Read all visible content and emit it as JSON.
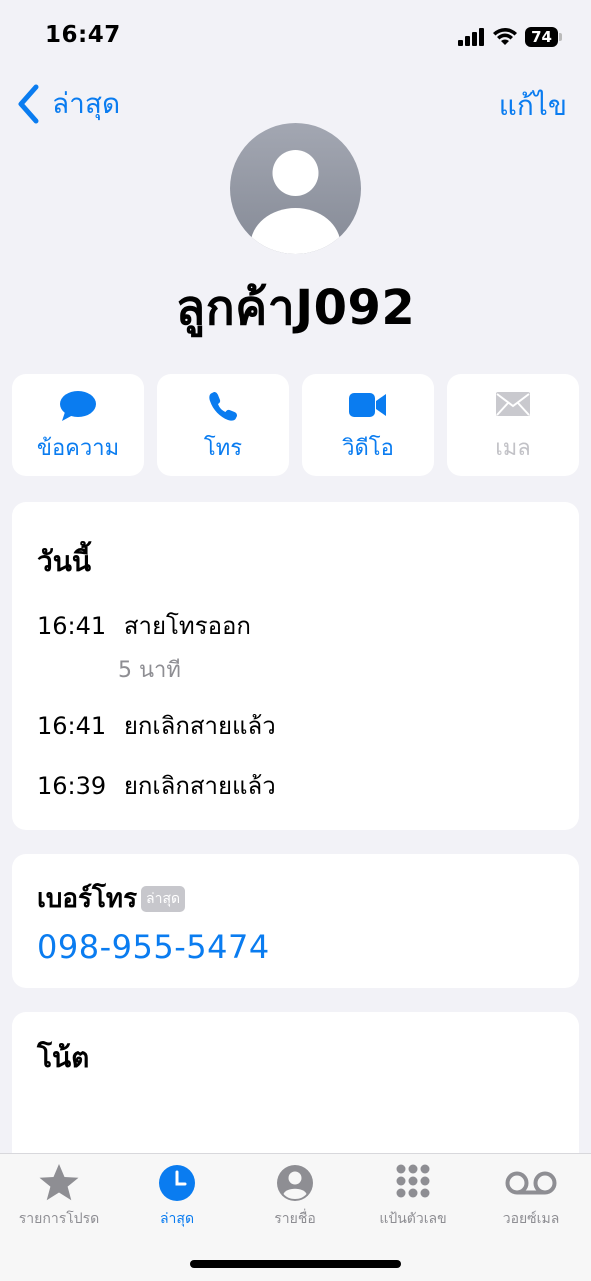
{
  "status": {
    "time": "16:47",
    "battery": "74"
  },
  "nav": {
    "back_label": "ล่าสุด",
    "edit_label": "แก้ไข"
  },
  "contact": {
    "name": "ลูกค้าJ092"
  },
  "actions": [
    {
      "label": "ข้อความ",
      "icon": "message-icon",
      "enabled": true
    },
    {
      "label": "โทร",
      "icon": "phone-icon",
      "enabled": true
    },
    {
      "label": "วิดีโอ",
      "icon": "video-icon",
      "enabled": true
    },
    {
      "label": "เมล",
      "icon": "mail-icon",
      "enabled": false
    }
  ],
  "recents": {
    "title": "วันนี้",
    "calls": [
      {
        "time": "16:41",
        "type": "สายโทรออก",
        "duration": "5 นาที"
      },
      {
        "time": "16:41",
        "type": "ยกเลิกสายแล้ว"
      },
      {
        "time": "16:39",
        "type": "ยกเลิกสายแล้ว"
      }
    ]
  },
  "phone": {
    "label": "เบอร์โทร",
    "badge": "ล่าสุด",
    "number": "098-955-5474"
  },
  "notes": {
    "title": "โน้ต"
  },
  "tabs": [
    {
      "label": "รายการโปรด",
      "icon": "star-icon",
      "active": false
    },
    {
      "label": "ล่าสุด",
      "icon": "clock-icon",
      "active": true
    },
    {
      "label": "รายชื่อ",
      "icon": "person-circle-icon",
      "active": false
    },
    {
      "label": "แป้นตัวเลข",
      "icon": "keypad-icon",
      "active": false
    },
    {
      "label": "วอยซ์เมล",
      "icon": "voicemail-icon",
      "active": false
    }
  ],
  "colors": {
    "accent": "#0a7cf0",
    "background": "#f2f2f7",
    "disabled": "#c2c2c7"
  }
}
